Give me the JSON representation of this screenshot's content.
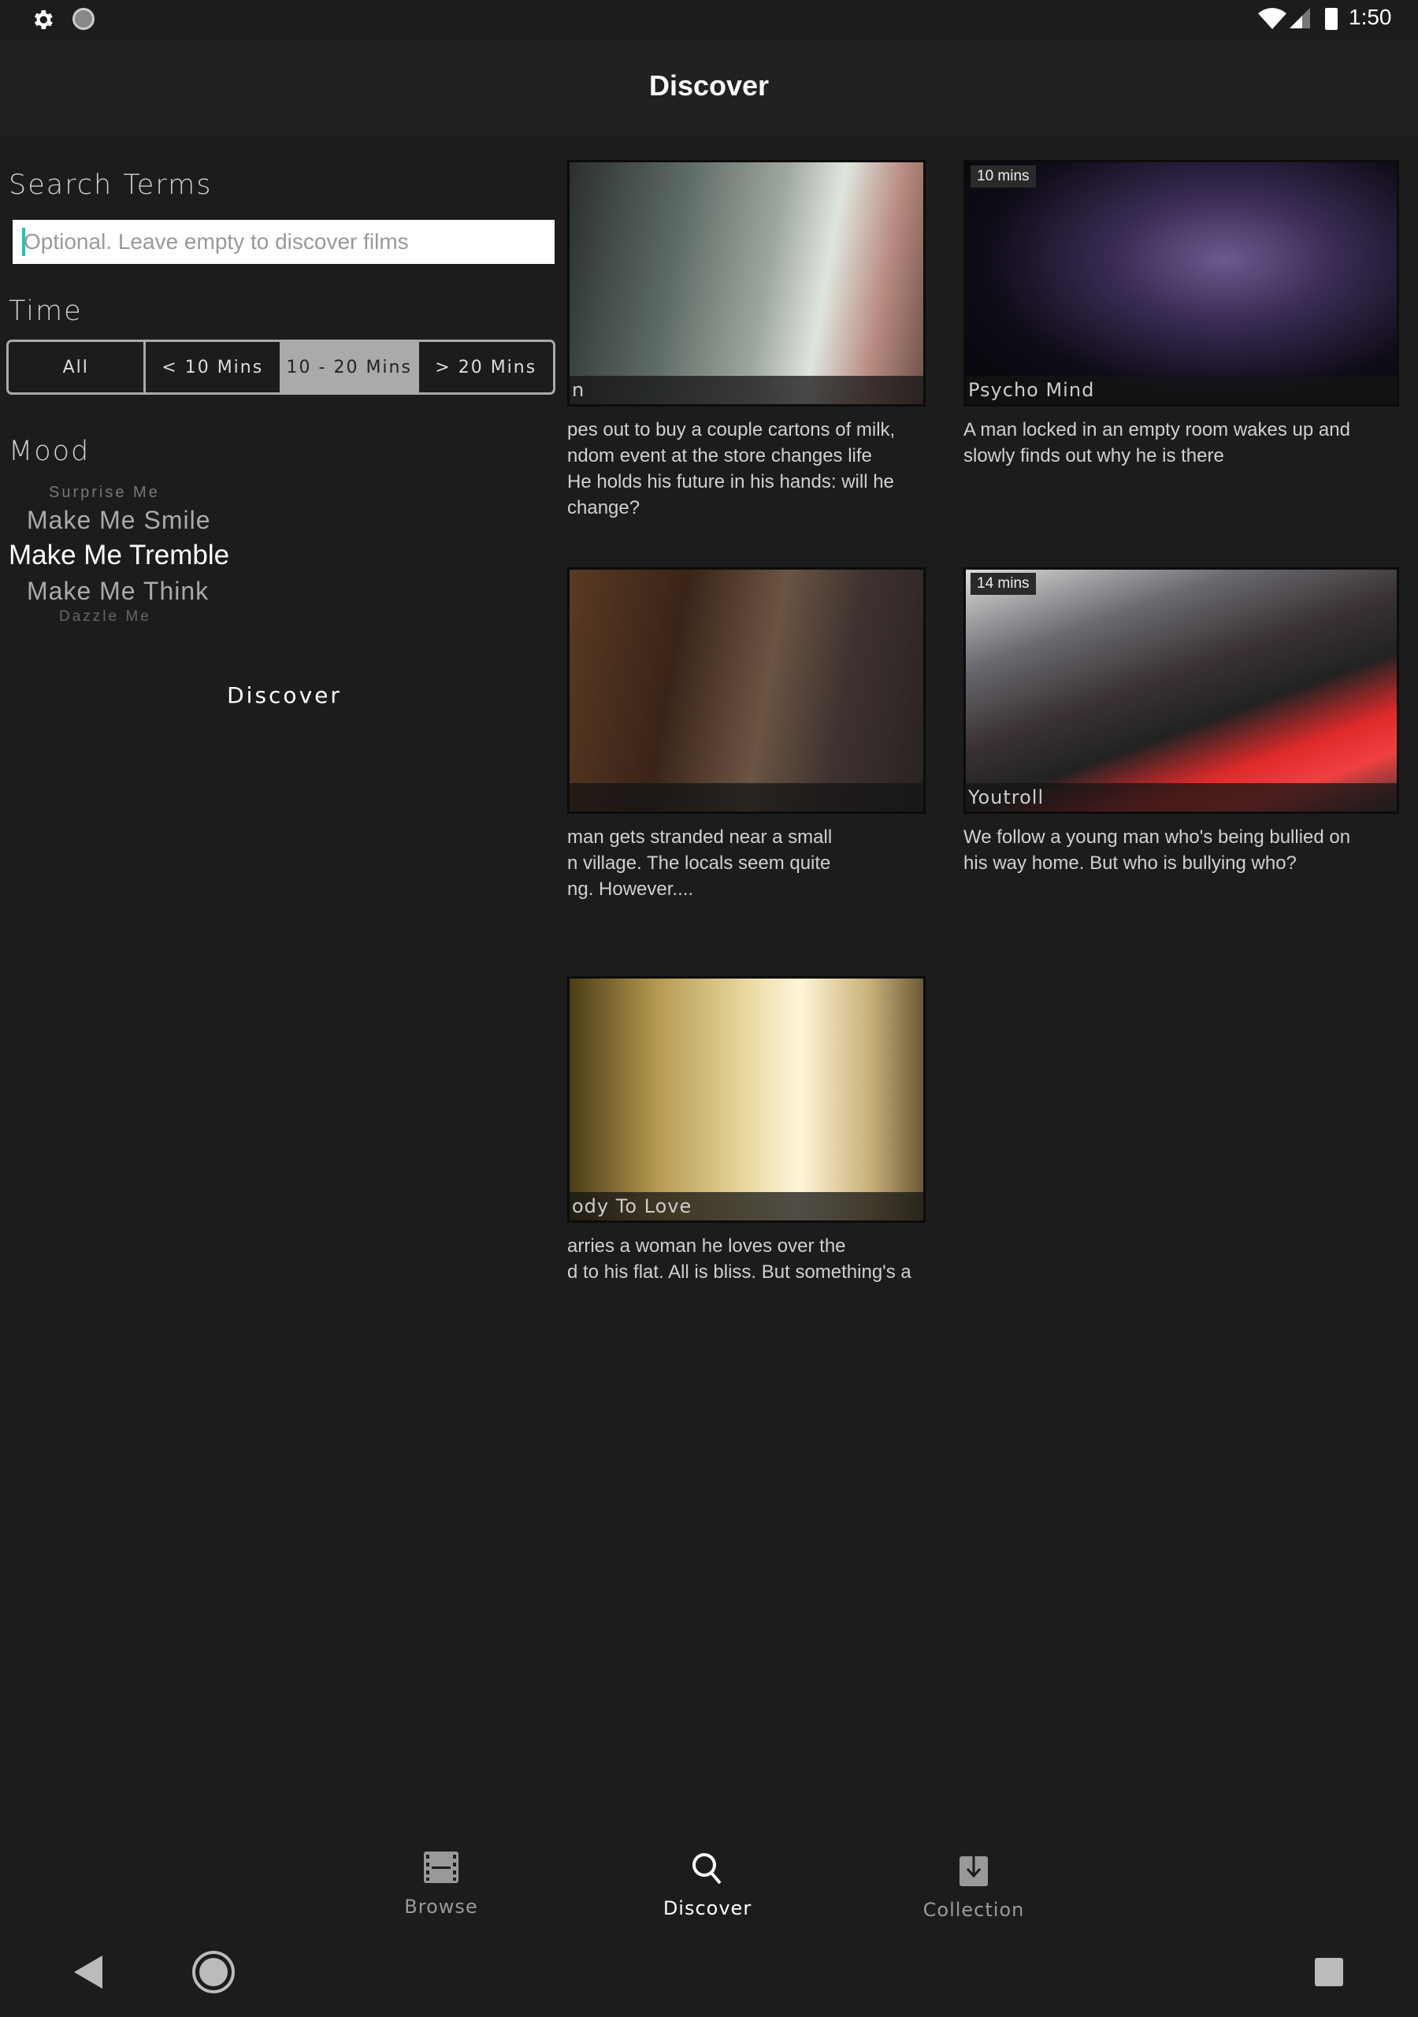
{
  "status_bar": {
    "time": "1:50",
    "icons": [
      "gear-icon",
      "circle-icon",
      "wifi-icon",
      "signal-icon",
      "battery-icon"
    ]
  },
  "header": {
    "title": "Discover"
  },
  "filters": {
    "search_label": "Search Terms",
    "search_placeholder": "Optional. Leave empty to discover films",
    "search_value": "",
    "time_label": "Time",
    "time_options": [
      "All",
      "< 10 Mins",
      "10 - 20 Mins",
      "> 20 Mins"
    ],
    "time_selected": "10 - 20 Mins",
    "mood_label": "Mood",
    "moods": [
      "Surprise Me",
      "Make Me Smile",
      "Make Me Tremble",
      "Make Me Think",
      "Dazzle Me"
    ],
    "mood_selected": "Make Me Tremble",
    "discover_button": "Discover"
  },
  "films": [
    {
      "title": "n",
      "duration": "",
      "desc": [
        "pes out to buy a couple cartons of milk,",
        "ndom event at the store changes life",
        "He holds his future in his hands: will he",
        "change?"
      ]
    },
    {
      "title": "Psycho Mind",
      "duration": "10 mins",
      "desc": [
        "A man locked in an empty room wakes up and",
        "slowly finds out why he is there"
      ]
    },
    {
      "title": "",
      "duration": "",
      "desc": [
        "man gets stranded near a small",
        "n village. The locals seem quite",
        "ng. However...."
      ]
    },
    {
      "title": "Youtroll",
      "duration": "14 mins",
      "desc": [
        "We follow a young man who's being bullied on",
        "his way home. But who is bullying who?"
      ]
    },
    {
      "title": "ody To Love",
      "duration": "",
      "desc": [
        "arries a woman he loves over the",
        "d to his flat. All is bliss. But something's a"
      ]
    }
  ],
  "bottom_nav": [
    {
      "label": "Browse",
      "icon": "film-icon"
    },
    {
      "label": "Discover",
      "icon": "search-icon",
      "active": true
    },
    {
      "label": "Collection",
      "icon": "download-icon"
    }
  ],
  "colors": {
    "background": "#1c1c1c",
    "header": "#212121",
    "accent_caret": "#1bc7b4",
    "segment_selected": "#aaaaaa"
  }
}
